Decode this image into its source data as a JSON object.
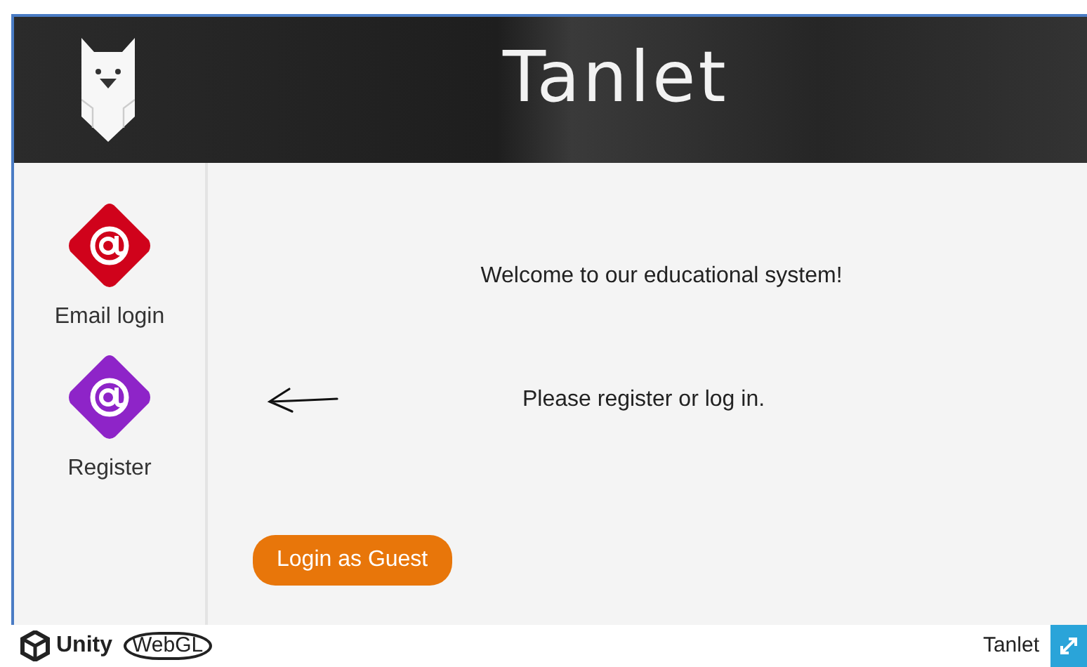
{
  "header": {
    "title": "Tanlet"
  },
  "sidebar": {
    "items": [
      {
        "label": "Email login",
        "color": "#d0021b"
      },
      {
        "label": "Register",
        "color": "#8e24c8"
      }
    ]
  },
  "content": {
    "welcome": "Welcome to our educational system!",
    "prompt": "Please register or log in.",
    "guest_button": "Login as Guest"
  },
  "footer": {
    "brand": "Unity",
    "platform": "WebGL",
    "title": "Tanlet"
  }
}
